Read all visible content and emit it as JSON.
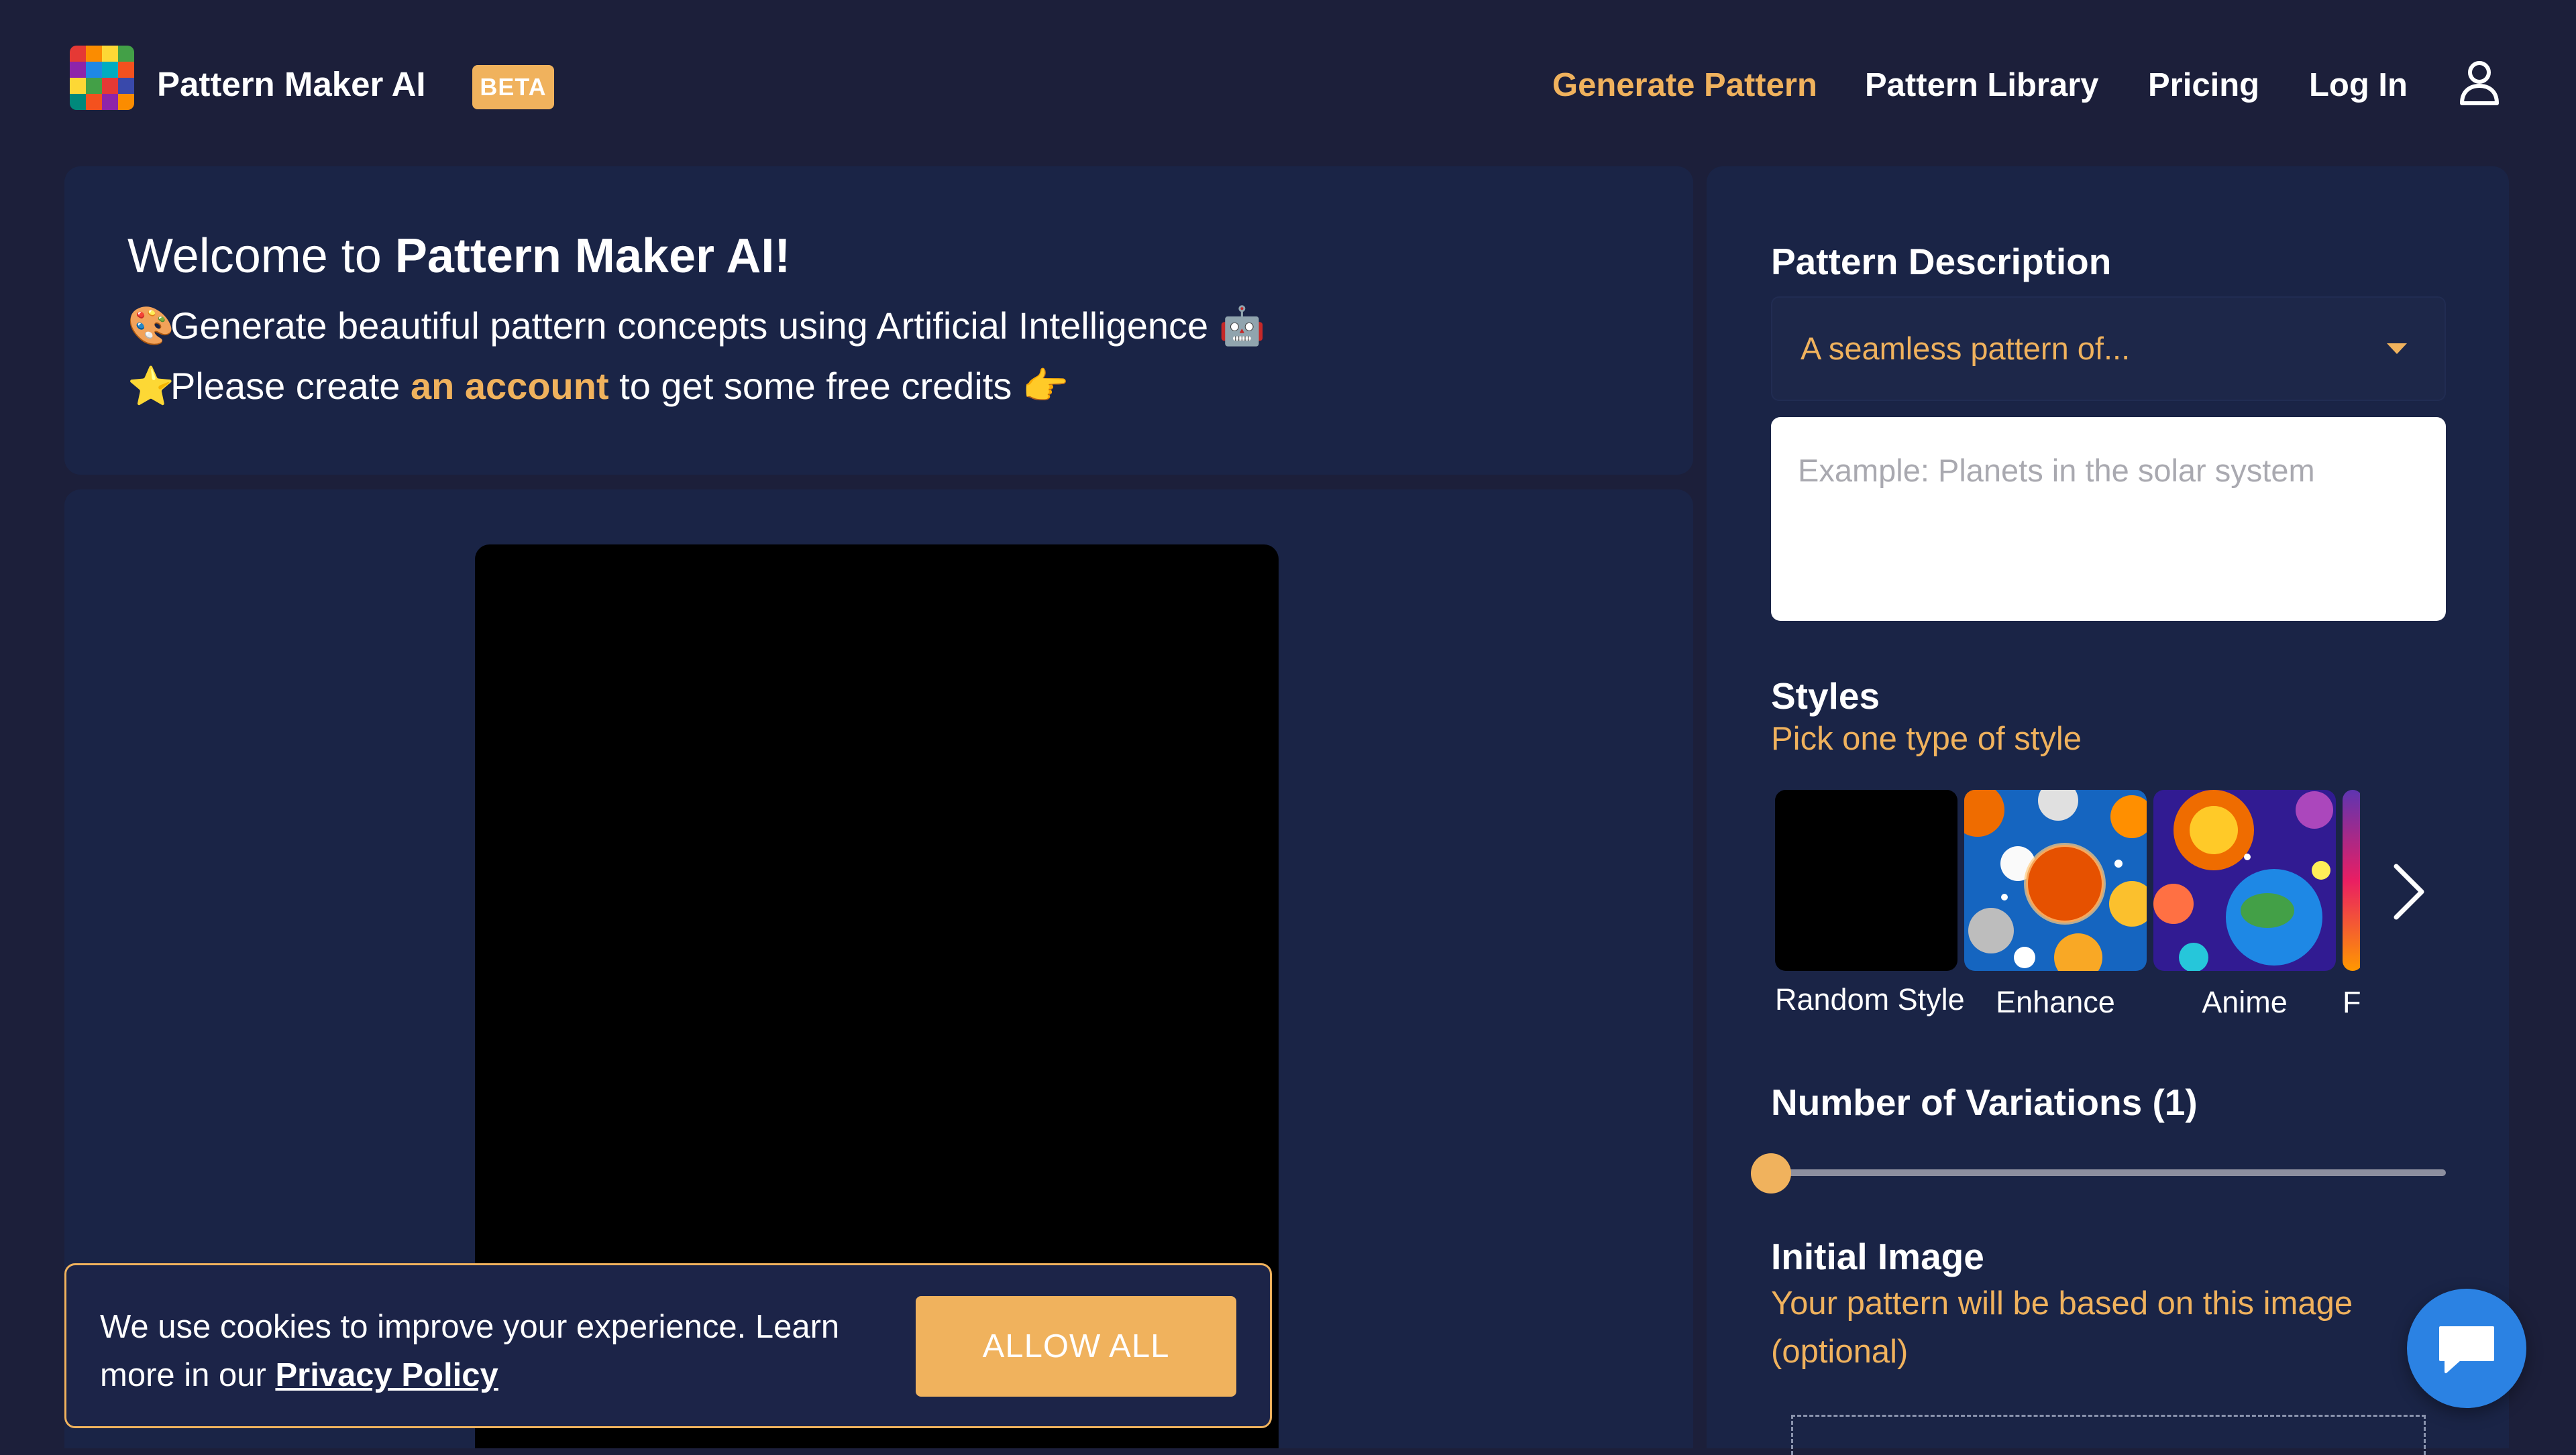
{
  "header": {
    "brand_name": "Pattern Maker AI",
    "badge": "BETA",
    "nav": [
      "Generate Pattern",
      "Pattern Library",
      "Pricing",
      "Log In"
    ],
    "active_nav": "Generate Pattern",
    "account_icon": "user-icon",
    "logo_icon": "colorful-grid-logo-icon"
  },
  "welcome": {
    "title_prefix": "Welcome to ",
    "title_bold": "Pattern Maker AI!",
    "line1_emoji": "🎨",
    "line1_text": "Generate beautiful pattern concepts using Artificial Intelligence",
    "line1_end_emoji": "🤖",
    "line2_emoji": "⭐",
    "line2_prefix": "Please create ",
    "line2_link": "an account",
    "line2_suffix": " to get some free credits",
    "line2_end_emoji": "👉"
  },
  "form": {
    "description_label": "Pattern Description",
    "description_select": "A seamless pattern of...",
    "description_placeholder": "Example: Planets in the solar system",
    "styles_label": "Styles",
    "styles_hint": "Pick one type of style",
    "styles": [
      {
        "name": "Random Style",
        "thumb": "black"
      },
      {
        "name": "Enhance",
        "thumb": "planets-blue"
      },
      {
        "name": "Anime",
        "thumb": "planets-fire"
      },
      {
        "name": "F",
        "thumb": "partial"
      }
    ],
    "variations_label": "Number of Variations (1)",
    "variations_value": 1,
    "initial_image_label": "Initial Image",
    "initial_image_hint": "Your pattern will be based on this image (optional)"
  },
  "cookie": {
    "text": "We use cookies to improve your experience. Learn more in our ",
    "link": "Privacy Policy",
    "button": "ALLOW ALL"
  },
  "colors": {
    "accent": "#f0b25d",
    "background": "#1c1f3a",
    "panel": "#1a2446",
    "chat": "#2b82e3"
  }
}
